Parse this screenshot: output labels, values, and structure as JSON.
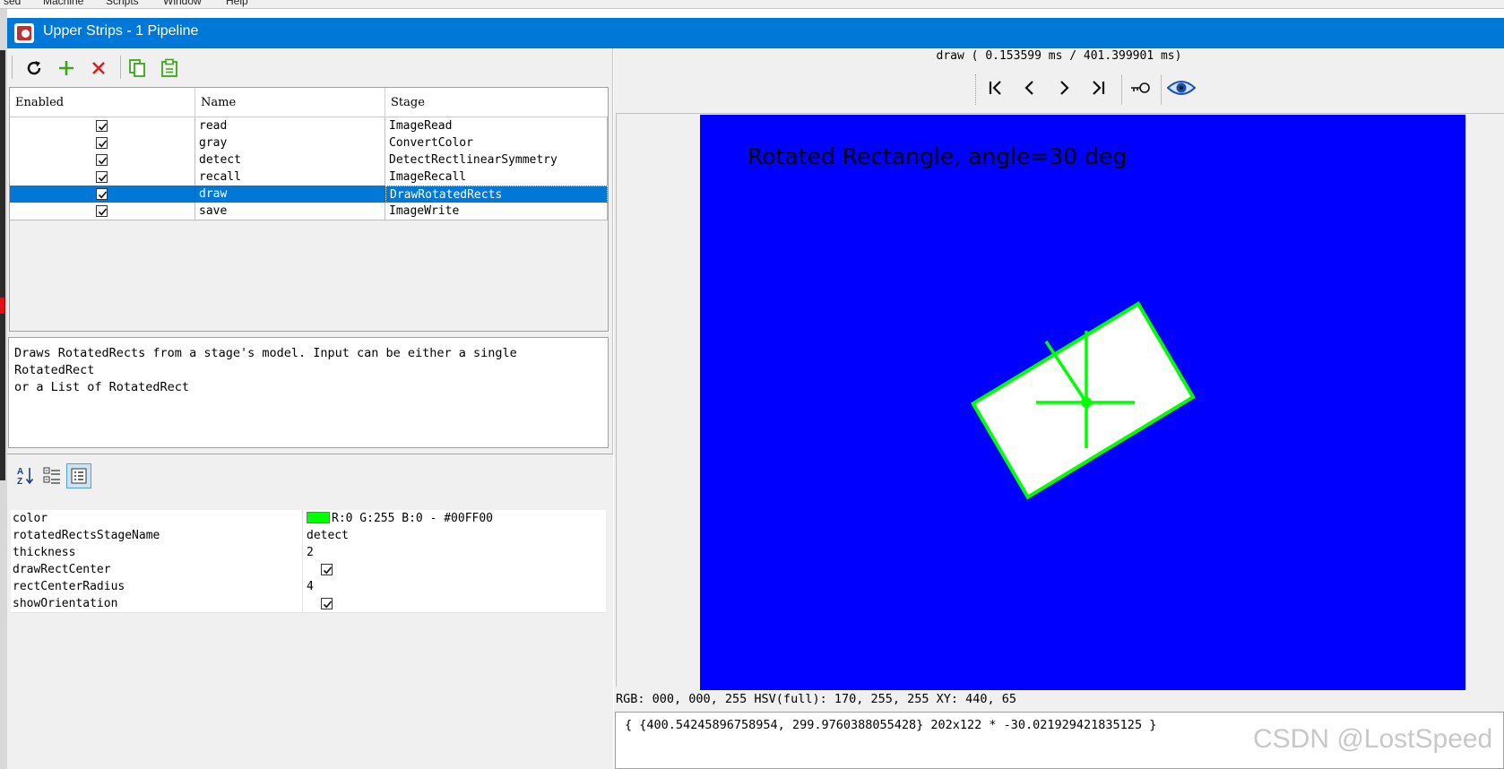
{
  "window": {
    "title": "Upper Strips - 1 Pipeline"
  },
  "menu_fragments": [
    "sed",
    "Machine",
    "Scripts",
    "Window",
    "Help"
  ],
  "toolbar": {
    "buttons": [
      {
        "name": "refresh",
        "icon": "refresh-icon"
      },
      {
        "name": "add",
        "icon": "plus-icon"
      },
      {
        "name": "delete",
        "icon": "red-x-icon"
      },
      {
        "name": "copy",
        "icon": "copy-icon"
      },
      {
        "name": "paste",
        "icon": "paste-icon"
      }
    ]
  },
  "stages_table": {
    "columns": [
      "Enabled",
      "Name",
      "Stage"
    ],
    "rows": [
      {
        "enabled": true,
        "name": "read",
        "stage": "ImageRead"
      },
      {
        "enabled": true,
        "name": "gray",
        "stage": "ConvertColor"
      },
      {
        "enabled": true,
        "name": "detect",
        "stage": "DetectRectlinearSymmetry"
      },
      {
        "enabled": true,
        "name": "recall",
        "stage": "ImageRecall"
      },
      {
        "enabled": true,
        "name": "draw",
        "stage": "DrawRotatedRects",
        "selected": true
      },
      {
        "enabled": true,
        "name": "save",
        "stage": "ImageWrite"
      }
    ]
  },
  "description": {
    "line1": "Draws RotatedRects from a stage's model. Input can be either a single RotatedRect",
    "line2": "or a List of RotatedRect"
  },
  "properties": {
    "view_buttons": [
      "sort-alpha-icon",
      "categorized-icon",
      "list-view-icon"
    ],
    "rows": [
      {
        "key": "color",
        "value": "R:0 G:255 B:0 - #00FF00",
        "swatch": "#00FF00"
      },
      {
        "key": "rotatedRectsStageName",
        "value": "detect"
      },
      {
        "key": "thickness",
        "value": "2"
      },
      {
        "key": "drawRectCenter",
        "checked": true
      },
      {
        "key": "rectCenterRadius",
        "value": "4"
      },
      {
        "key": "showOrientation",
        "checked": true
      }
    ]
  },
  "viewer": {
    "timing": "draw ( 0.153599 ms / 401.399901 ms)",
    "nav_buttons": [
      "first-icon",
      "prev-icon",
      "next-icon",
      "last-icon",
      "key-icon",
      "eye-icon"
    ],
    "image_text": "Rotated Rectangle, angle=30 deg",
    "image_background": "#0000FF",
    "rect_color": "#00FF00",
    "pixel_info": "RGB: 000, 000, 255 HSV(full): 170, 255, 255 XY: 440, 65",
    "model": "{ {400.54245896758954, 299.9760388055428} 202x122 * -30.021929421835125 }"
  },
  "watermark": "CSDN @LostSpeed",
  "colors": {
    "titlebar": "#0078d7",
    "selection": "#0078d7",
    "accent_green": "#00ff00"
  }
}
